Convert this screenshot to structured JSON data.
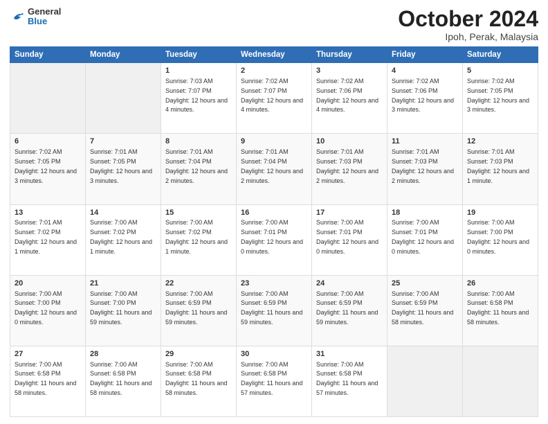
{
  "logo": {
    "general": "General",
    "blue": "Blue"
  },
  "title": "October 2024",
  "subtitle": "Ipoh, Perak, Malaysia",
  "days_header": [
    "Sunday",
    "Monday",
    "Tuesday",
    "Wednesday",
    "Thursday",
    "Friday",
    "Saturday"
  ],
  "weeks": [
    [
      {
        "day": "",
        "info": ""
      },
      {
        "day": "",
        "info": ""
      },
      {
        "day": "1",
        "info": "Sunrise: 7:03 AM\nSunset: 7:07 PM\nDaylight: 12 hours and 4 minutes."
      },
      {
        "day": "2",
        "info": "Sunrise: 7:02 AM\nSunset: 7:07 PM\nDaylight: 12 hours and 4 minutes."
      },
      {
        "day": "3",
        "info": "Sunrise: 7:02 AM\nSunset: 7:06 PM\nDaylight: 12 hours and 4 minutes."
      },
      {
        "day": "4",
        "info": "Sunrise: 7:02 AM\nSunset: 7:06 PM\nDaylight: 12 hours and 3 minutes."
      },
      {
        "day": "5",
        "info": "Sunrise: 7:02 AM\nSunset: 7:05 PM\nDaylight: 12 hours and 3 minutes."
      }
    ],
    [
      {
        "day": "6",
        "info": "Sunrise: 7:02 AM\nSunset: 7:05 PM\nDaylight: 12 hours and 3 minutes."
      },
      {
        "day": "7",
        "info": "Sunrise: 7:01 AM\nSunset: 7:05 PM\nDaylight: 12 hours and 3 minutes."
      },
      {
        "day": "8",
        "info": "Sunrise: 7:01 AM\nSunset: 7:04 PM\nDaylight: 12 hours and 2 minutes."
      },
      {
        "day": "9",
        "info": "Sunrise: 7:01 AM\nSunset: 7:04 PM\nDaylight: 12 hours and 2 minutes."
      },
      {
        "day": "10",
        "info": "Sunrise: 7:01 AM\nSunset: 7:03 PM\nDaylight: 12 hours and 2 minutes."
      },
      {
        "day": "11",
        "info": "Sunrise: 7:01 AM\nSunset: 7:03 PM\nDaylight: 12 hours and 2 minutes."
      },
      {
        "day": "12",
        "info": "Sunrise: 7:01 AM\nSunset: 7:03 PM\nDaylight: 12 hours and 1 minute."
      }
    ],
    [
      {
        "day": "13",
        "info": "Sunrise: 7:01 AM\nSunset: 7:02 PM\nDaylight: 12 hours and 1 minute."
      },
      {
        "day": "14",
        "info": "Sunrise: 7:00 AM\nSunset: 7:02 PM\nDaylight: 12 hours and 1 minute."
      },
      {
        "day": "15",
        "info": "Sunrise: 7:00 AM\nSunset: 7:02 PM\nDaylight: 12 hours and 1 minute."
      },
      {
        "day": "16",
        "info": "Sunrise: 7:00 AM\nSunset: 7:01 PM\nDaylight: 12 hours and 0 minutes."
      },
      {
        "day": "17",
        "info": "Sunrise: 7:00 AM\nSunset: 7:01 PM\nDaylight: 12 hours and 0 minutes."
      },
      {
        "day": "18",
        "info": "Sunrise: 7:00 AM\nSunset: 7:01 PM\nDaylight: 12 hours and 0 minutes."
      },
      {
        "day": "19",
        "info": "Sunrise: 7:00 AM\nSunset: 7:00 PM\nDaylight: 12 hours and 0 minutes."
      }
    ],
    [
      {
        "day": "20",
        "info": "Sunrise: 7:00 AM\nSunset: 7:00 PM\nDaylight: 12 hours and 0 minutes."
      },
      {
        "day": "21",
        "info": "Sunrise: 7:00 AM\nSunset: 7:00 PM\nDaylight: 11 hours and 59 minutes."
      },
      {
        "day": "22",
        "info": "Sunrise: 7:00 AM\nSunset: 6:59 PM\nDaylight: 11 hours and 59 minutes."
      },
      {
        "day": "23",
        "info": "Sunrise: 7:00 AM\nSunset: 6:59 PM\nDaylight: 11 hours and 59 minutes."
      },
      {
        "day": "24",
        "info": "Sunrise: 7:00 AM\nSunset: 6:59 PM\nDaylight: 11 hours and 59 minutes."
      },
      {
        "day": "25",
        "info": "Sunrise: 7:00 AM\nSunset: 6:59 PM\nDaylight: 11 hours and 58 minutes."
      },
      {
        "day": "26",
        "info": "Sunrise: 7:00 AM\nSunset: 6:58 PM\nDaylight: 11 hours and 58 minutes."
      }
    ],
    [
      {
        "day": "27",
        "info": "Sunrise: 7:00 AM\nSunset: 6:58 PM\nDaylight: 11 hours and 58 minutes."
      },
      {
        "day": "28",
        "info": "Sunrise: 7:00 AM\nSunset: 6:58 PM\nDaylight: 11 hours and 58 minutes."
      },
      {
        "day": "29",
        "info": "Sunrise: 7:00 AM\nSunset: 6:58 PM\nDaylight: 11 hours and 58 minutes."
      },
      {
        "day": "30",
        "info": "Sunrise: 7:00 AM\nSunset: 6:58 PM\nDaylight: 11 hours and 57 minutes."
      },
      {
        "day": "31",
        "info": "Sunrise: 7:00 AM\nSunset: 6:58 PM\nDaylight: 11 hours and 57 minutes."
      },
      {
        "day": "",
        "info": ""
      },
      {
        "day": "",
        "info": ""
      }
    ]
  ]
}
